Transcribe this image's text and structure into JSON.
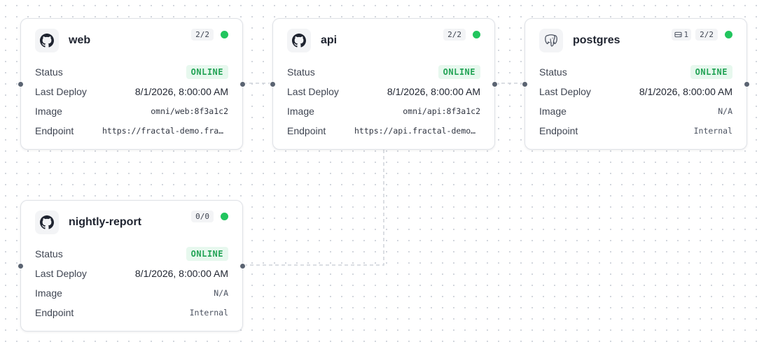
{
  "canvas": {
    "nodes": [
      {
        "id": "web",
        "name": "web",
        "icon": "github-icon",
        "volumes": "",
        "replicas": "2/2",
        "health_color": "#22c55e",
        "rows": {
          "status_label": "Status",
          "status_value": "ONLINE",
          "deploy_label": "Last Deploy",
          "deploy_value": "8/1/2026, 8:00:00 AM",
          "image_label": "Image",
          "image_value": "omni/web:8f3a1c2",
          "endpoint_label": "Endpoint",
          "endpoint_value": "https://fractal-demo.fractal.app"
        }
      },
      {
        "id": "api",
        "name": "api",
        "icon": "github-icon",
        "volumes": "",
        "replicas": "2/2",
        "health_color": "#22c55e",
        "rows": {
          "status_label": "Status",
          "status_value": "ONLINE",
          "deploy_label": "Last Deploy",
          "deploy_value": "8/1/2026, 8:00:00 AM",
          "image_label": "Image",
          "image_value": "omni/api:8f3a1c2",
          "endpoint_label": "Endpoint",
          "endpoint_value": "https://api.fractal-demo.fractal.app"
        }
      },
      {
        "id": "postgres",
        "name": "postgres",
        "icon": "postgres-elephant-icon",
        "volumes": "1",
        "replicas": "2/2",
        "health_color": "#22c55e",
        "rows": {
          "status_label": "Status",
          "status_value": "ONLINE",
          "deploy_label": "Last Deploy",
          "deploy_value": "8/1/2026, 8:00:00 AM",
          "image_label": "Image",
          "image_value": "N/A",
          "endpoint_label": "Endpoint",
          "endpoint_value": "Internal"
        }
      },
      {
        "id": "nightly-report",
        "name": "nightly-report",
        "icon": "github-icon",
        "volumes": "",
        "replicas": "0/0",
        "health_color": "#22c55e",
        "rows": {
          "status_label": "Status",
          "status_value": "ONLINE",
          "deploy_label": "Last Deploy",
          "deploy_value": "8/1/2026, 8:00:00 AM",
          "image_label": "Image",
          "image_value": "N/A",
          "endpoint_label": "Endpoint",
          "endpoint_value": "Internal"
        }
      }
    ],
    "edges": [
      {
        "from": "web",
        "to": "api"
      },
      {
        "from": "api",
        "to": "postgres"
      },
      {
        "from": "api",
        "to": "nightly-report"
      }
    ]
  }
}
